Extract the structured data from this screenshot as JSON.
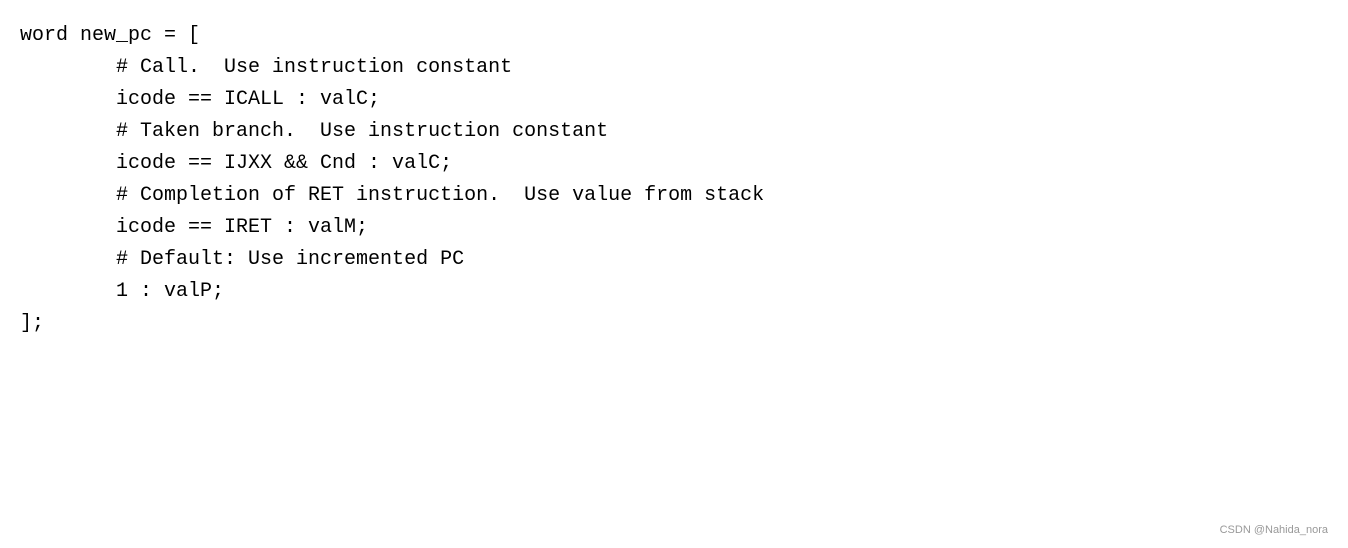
{
  "code": {
    "lines": [
      {
        "id": "line1",
        "text": "word new_pc = ["
      },
      {
        "id": "line2",
        "text": "        # Call.  Use instruction constant"
      },
      {
        "id": "line3",
        "text": "        icode == ICALL : valC;"
      },
      {
        "id": "line4",
        "text": "        # Taken branch.  Use instruction constant"
      },
      {
        "id": "line5",
        "text": "        icode == IJXX && Cnd : valC;"
      },
      {
        "id": "line6",
        "text": "        # Completion of RET instruction.  Use value from stack"
      },
      {
        "id": "line7",
        "text": "        icode == IRET : valM;"
      },
      {
        "id": "line8",
        "text": "        # Default: Use incremented PC"
      },
      {
        "id": "line9",
        "text": "        1 : valP;"
      },
      {
        "id": "line10",
        "text": "];"
      }
    ],
    "watermark": "CSDN @Nahida_nora"
  }
}
